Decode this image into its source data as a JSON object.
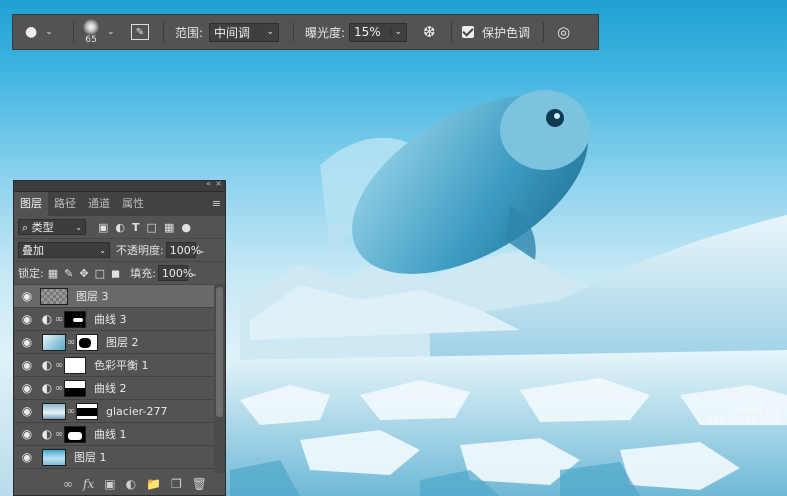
{
  "options_bar": {
    "brush_size": "65",
    "range_label": "范围:",
    "range_value": "中间调",
    "exposure_label": "曝光度:",
    "exposure_value": "15%",
    "protect_tones_label": "保护色调",
    "protect_tones_checked": true
  },
  "layers_panel": {
    "tabs": [
      "图层",
      "路径",
      "通道",
      "属性"
    ],
    "filter_kind": "类型",
    "blend_mode": "叠加",
    "opacity_label": "不透明度:",
    "opacity_value": "100%",
    "lock_label": "锁定:",
    "fill_label": "填充:",
    "fill_value": "100%",
    "layers": [
      {
        "name": "图层 3",
        "kind": "pixel",
        "selected": true
      },
      {
        "name": "曲线 3",
        "kind": "adjustment"
      },
      {
        "name": "图层 2",
        "kind": "pixel-masked"
      },
      {
        "name": "色彩平衡 1",
        "kind": "adjustment"
      },
      {
        "name": "曲线 2",
        "kind": "adjustment"
      },
      {
        "name": "glacier-277",
        "kind": "pixel-masked"
      },
      {
        "name": "曲线 1",
        "kind": "adjustment"
      },
      {
        "name": "图层 1",
        "kind": "pixel"
      }
    ],
    "bottom_icons": [
      "link-icon",
      "fx-icon",
      "add-mask-icon",
      "adjustment-icon",
      "folder-icon",
      "new-layer-icon",
      "trash-icon"
    ]
  },
  "watermark": "PS教程论坛\nBBS.16XX8.COM"
}
